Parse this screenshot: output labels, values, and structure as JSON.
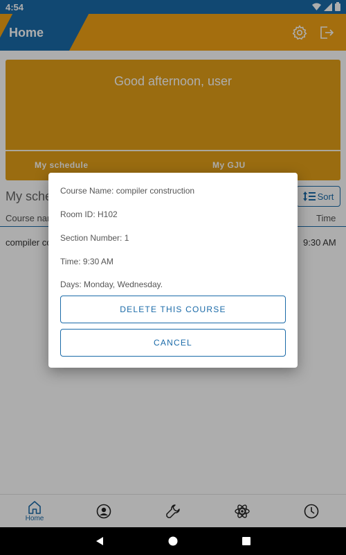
{
  "status_bar": {
    "time": "4:54"
  },
  "app_bar": {
    "title": "Home",
    "icons": [
      "settings-icon",
      "logout-icon"
    ]
  },
  "hero": {
    "greeting": "Good afternoon,  user",
    "tabs": [
      {
        "label": "My schedule"
      },
      {
        "label": "My GJU"
      }
    ]
  },
  "schedule": {
    "title": "My sche",
    "sort_label": "Sort",
    "columns": [
      "Course nam",
      "Time"
    ],
    "rows": [
      {
        "course": "compiler co",
        "time": "9:30 AM"
      }
    ]
  },
  "dialog": {
    "course_name": "Course Name: compiler construction",
    "room_id": "Room ID: H102",
    "section": "Section Number: 1",
    "time": "Time: 9:30 AM",
    "days": "Days: Monday, Wednesday.",
    "delete_label": "DELETE THIS COURSE",
    "cancel_label": "CANCEL"
  },
  "bottom_nav": {
    "items": [
      {
        "label": "Home",
        "icon": "home-icon",
        "active": true
      },
      {
        "label": "",
        "icon": "profile-icon"
      },
      {
        "label": "",
        "icon": "wrench-icon"
      },
      {
        "label": "",
        "icon": "atom-icon"
      },
      {
        "label": "",
        "icon": "clock-icon"
      }
    ]
  },
  "colors": {
    "primary": "#1a6aa8",
    "accent": "#f2a315"
  }
}
